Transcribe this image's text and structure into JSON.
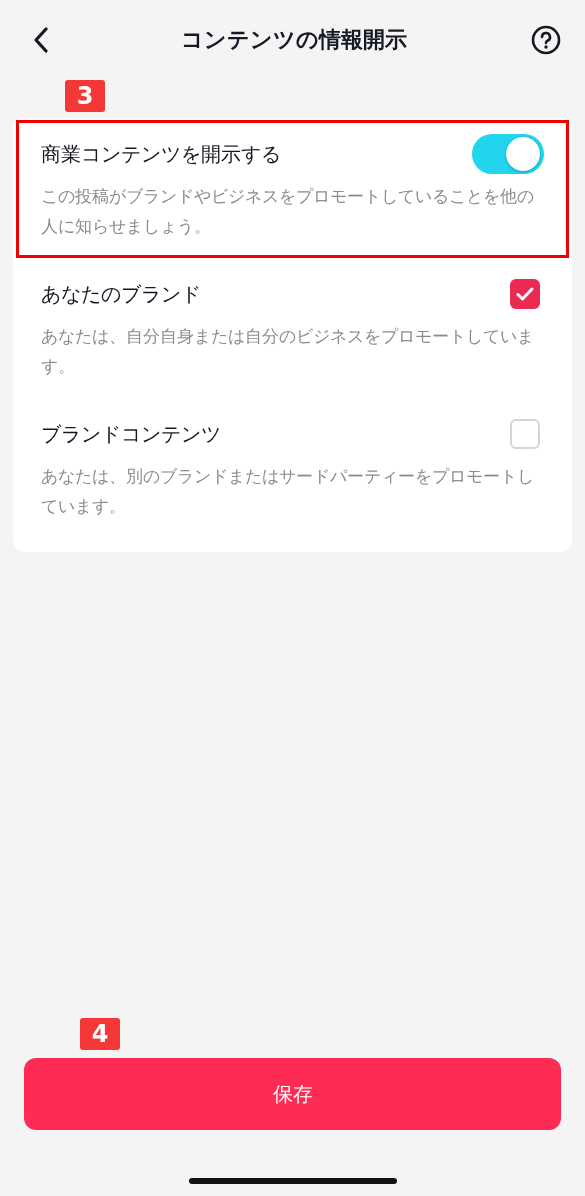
{
  "header": {
    "title": "コンテンツの情報開示"
  },
  "callouts": [
    {
      "label": "3"
    },
    {
      "label": "4"
    }
  ],
  "options": [
    {
      "kind": "toggle",
      "title": "商業コンテンツを開示する",
      "description": "この投稿がブランドやビジネスをプロモートしていることを他の人に知らせましょう。",
      "on": true,
      "highlighted": true
    },
    {
      "kind": "checkbox",
      "title": "あなたのブランド",
      "description": "あなたは、自分自身または自分のビジネスをプロモートしています。",
      "checked": true,
      "highlighted": false
    },
    {
      "kind": "checkbox",
      "title": "ブランドコンテンツ",
      "description": "あなたは、別のブランドまたはサードパーティーをプロモートしています。",
      "checked": false,
      "highlighted": false
    }
  ],
  "save_button": {
    "label": "保存"
  }
}
